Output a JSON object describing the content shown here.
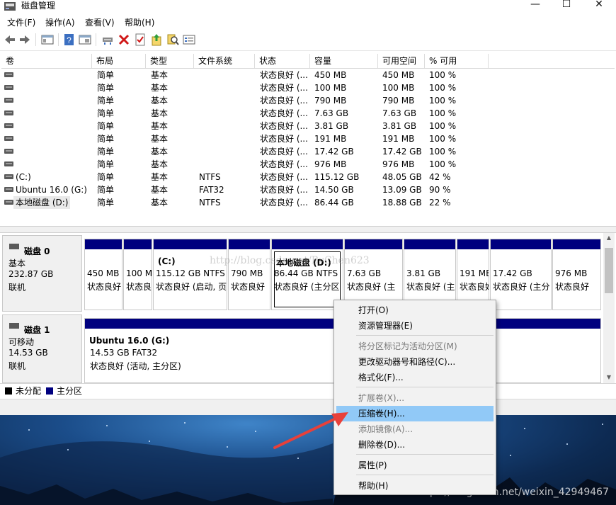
{
  "window": {
    "title": "磁盘管理",
    "minimize": "—",
    "maximize": "☐",
    "close": "✕"
  },
  "menu": [
    "文件(F)",
    "操作(A)",
    "查看(V)",
    "帮助(H)"
  ],
  "toolbar_icons": [
    "back-icon",
    "forward-icon",
    "show-hide-console-icon",
    "help-icon",
    "properties-icon",
    "connect-icon",
    "delete-icon",
    "checklist-icon",
    "export-icon",
    "search-icon",
    "properties-sheet-icon"
  ],
  "columns": [
    "卷",
    "布局",
    "类型",
    "文件系统",
    "状态",
    "容量",
    "可用空间",
    "% 可用"
  ],
  "volumes": [
    {
      "name": "",
      "layout": "简单",
      "type": "基本",
      "fs": "",
      "status": "状态良好 (...",
      "capacity": "450 MB",
      "free": "450 MB",
      "pct": "100 %"
    },
    {
      "name": "",
      "layout": "简单",
      "type": "基本",
      "fs": "",
      "status": "状态良好 (...",
      "capacity": "100 MB",
      "free": "100 MB",
      "pct": "100 %"
    },
    {
      "name": "",
      "layout": "简单",
      "type": "基本",
      "fs": "",
      "status": "状态良好 (...",
      "capacity": "790 MB",
      "free": "790 MB",
      "pct": "100 %"
    },
    {
      "name": "",
      "layout": "简单",
      "type": "基本",
      "fs": "",
      "status": "状态良好 (...",
      "capacity": "7.63 GB",
      "free": "7.63 GB",
      "pct": "100 %"
    },
    {
      "name": "",
      "layout": "简单",
      "type": "基本",
      "fs": "",
      "status": "状态良好 (...",
      "capacity": "3.81 GB",
      "free": "3.81 GB",
      "pct": "100 %"
    },
    {
      "name": "",
      "layout": "简单",
      "type": "基本",
      "fs": "",
      "status": "状态良好 (...",
      "capacity": "191 MB",
      "free": "191 MB",
      "pct": "100 %"
    },
    {
      "name": "",
      "layout": "简单",
      "type": "基本",
      "fs": "",
      "status": "状态良好 (...",
      "capacity": "17.42 GB",
      "free": "17.42 GB",
      "pct": "100 %"
    },
    {
      "name": "",
      "layout": "简单",
      "type": "基本",
      "fs": "",
      "status": "状态良好 (...",
      "capacity": "976 MB",
      "free": "976 MB",
      "pct": "100 %"
    },
    {
      "name": "(C:)",
      "layout": "简单",
      "type": "基本",
      "fs": "NTFS",
      "status": "状态良好 (...",
      "capacity": "115.12 GB",
      "free": "48.05 GB",
      "pct": "42 %"
    },
    {
      "name": "Ubuntu 16.0 (G:)",
      "layout": "简单",
      "type": "基本",
      "fs": "FAT32",
      "status": "状态良好 (...",
      "capacity": "14.50 GB",
      "free": "13.09 GB",
      "pct": "90 %"
    },
    {
      "name": "本地磁盘 (D:)",
      "layout": "简单",
      "type": "基本",
      "fs": "NTFS",
      "status": "状态良好 (...",
      "capacity": "86.44 GB",
      "free": "18.88 GB",
      "pct": "22 %"
    }
  ],
  "disk0": {
    "title": "磁盘 0",
    "kind": "基本",
    "size": "232.87 GB",
    "state": "联机",
    "partitions": [
      {
        "name": "",
        "l1": "450 MB",
        "l2": "状态良好"
      },
      {
        "name": "",
        "l1": "100 MB",
        "l2": "状态良好"
      },
      {
        "name": "(C:)",
        "l1": "115.12 GB NTFS",
        "l2": "状态良好 (启动, 页"
      },
      {
        "name": "",
        "l1": "790 MB",
        "l2": "状态良好"
      },
      {
        "name": "本地磁盘   (D:)",
        "l1": "86.44 GB NTFS",
        "l2": "状态良好 (主分区"
      },
      {
        "name": "",
        "l1": "7.63 GB",
        "l2": "状态良好 (主"
      },
      {
        "name": "",
        "l1": "3.81 GB",
        "l2": "状态良好 (主"
      },
      {
        "name": "",
        "l1": "191 MB",
        "l2": "状态良好"
      },
      {
        "name": "",
        "l1": "17.42 GB",
        "l2": "状态良好 (主分"
      },
      {
        "name": "",
        "l1": "976 MB",
        "l2": "状态良好"
      }
    ]
  },
  "disk1": {
    "title": "磁盘 1",
    "kind": "可移动",
    "size": "14.53 GB",
    "state": "联机",
    "partition": {
      "name": "Ubuntu 16.0   (G:)",
      "l1": "14.53 GB FAT32",
      "l2": "状态良好 (活动, 主分区)"
    }
  },
  "legend": {
    "unallocated": "未分配",
    "primary": "主分区",
    "unallocated_color": "#000000",
    "primary_color": "#00007f"
  },
  "context_menu": [
    {
      "label": "打开(O)",
      "enabled": true
    },
    {
      "label": "资源管理器(E)",
      "enabled": true
    },
    {
      "label": "将分区标记为活动分区(M)",
      "enabled": false
    },
    {
      "label": "更改驱动器号和路径(C)...",
      "enabled": true
    },
    {
      "label": "格式化(F)...",
      "enabled": true
    },
    {
      "label": "扩展卷(X)...",
      "enabled": false
    },
    {
      "label": "压缩卷(H)...",
      "enabled": true,
      "highlighted": true
    },
    {
      "label": "添加镜像(A)...",
      "enabled": false
    },
    {
      "label": "删除卷(D)...",
      "enabled": true
    },
    {
      "label": "属性(P)",
      "enabled": true
    },
    {
      "label": "帮助(H)",
      "enabled": true
    }
  ],
  "watermarks": {
    "overlay": "http://blog.csdn.net/ByChen623",
    "desktop": "https://blog.csdn.net/weixin_42949467"
  },
  "colors": {
    "partition_band": "#00007f",
    "menu_highlight": "#91c9f7",
    "arrow": "#e8403a"
  }
}
